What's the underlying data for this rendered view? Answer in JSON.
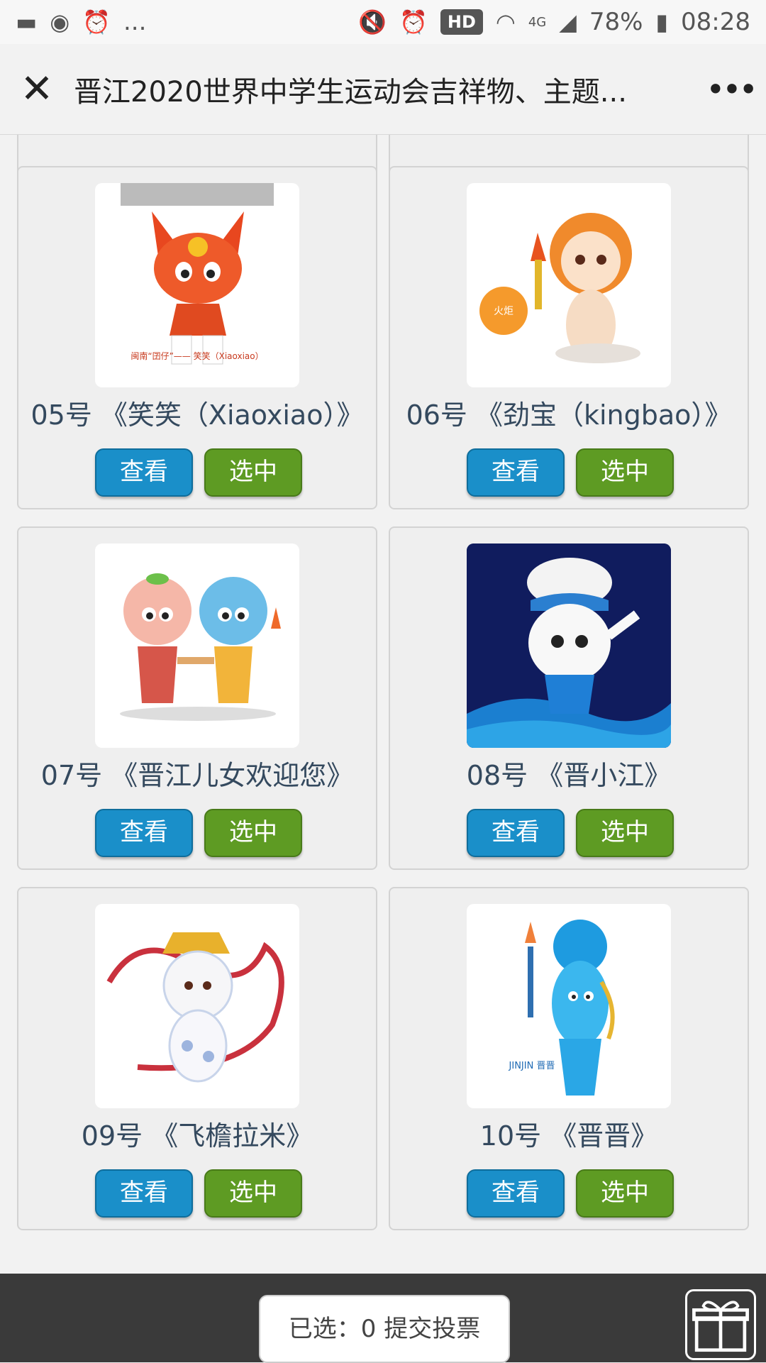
{
  "status_bar": {
    "left_icons": [
      "folder-icon",
      "music-icon",
      "alarm-icon"
    ],
    "overflow": "...",
    "network": "HD",
    "signal_label": "4G",
    "battery": "78%",
    "time": "08:28"
  },
  "nav": {
    "close_glyph": "✕",
    "title": "晋江2020世界中学生运动会吉祥物、主题...",
    "more_glyph": "•••"
  },
  "cards": [
    {
      "title": "05号 《笑笑（Xiaoxiao）》",
      "view": "查看",
      "select": "选中",
      "caption": "闽南“囝仔”——  笑笑（Xiaoxiao）"
    },
    {
      "title": "06号 《劲宝（kingbao）》",
      "view": "查看",
      "select": "选中",
      "badge": "火炬"
    },
    {
      "title": "07号 《晋江儿女欢迎您》",
      "view": "查看",
      "select": "选中"
    },
    {
      "title": "08号 《晋小江》",
      "view": "查看",
      "select": "选中"
    },
    {
      "title": "09号 《飞檐拉米》",
      "view": "查看",
      "select": "选中"
    },
    {
      "title": "10号 《晋晋》",
      "view": "查看",
      "select": "选中",
      "caption": "JINJIN 晋晋"
    }
  ],
  "footer": {
    "submit_label": "已选：0  提交投票"
  },
  "colors": {
    "view_button": "#1a8fc9",
    "select_button": "#5e9b23",
    "footer_bg": "#3a3a3a"
  }
}
